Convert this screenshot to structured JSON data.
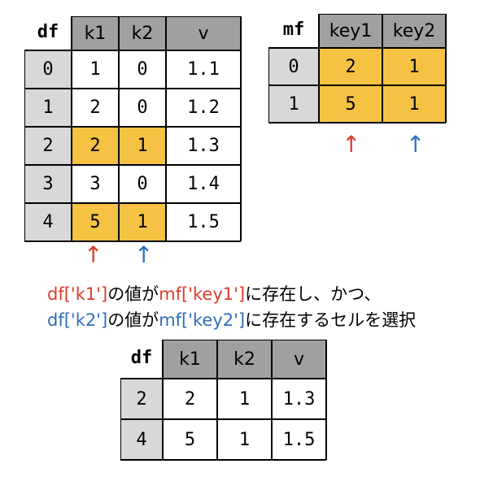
{
  "df": {
    "label": "df",
    "columns": [
      "k1",
      "k2",
      "v"
    ],
    "rows": [
      {
        "index": "0",
        "values": [
          "1",
          "0",
          "1.1"
        ],
        "highlight": [
          false,
          false,
          false
        ]
      },
      {
        "index": "1",
        "values": [
          "2",
          "0",
          "1.2"
        ],
        "highlight": [
          false,
          false,
          false
        ]
      },
      {
        "index": "2",
        "values": [
          "2",
          "1",
          "1.3"
        ],
        "highlight": [
          true,
          true,
          false
        ]
      },
      {
        "index": "3",
        "values": [
          "3",
          "0",
          "1.4"
        ],
        "highlight": [
          false,
          false,
          false
        ]
      },
      {
        "index": "4",
        "values": [
          "5",
          "1",
          "1.5"
        ],
        "highlight": [
          true,
          true,
          false
        ]
      }
    ]
  },
  "mf": {
    "label": "mf",
    "columns": [
      "key1",
      "key2"
    ],
    "rows": [
      {
        "index": "0",
        "values": [
          "2",
          "1"
        ],
        "highlight": [
          true,
          true
        ]
      },
      {
        "index": "1",
        "values": [
          "5",
          "1"
        ],
        "highlight": [
          true,
          true
        ]
      }
    ]
  },
  "result": {
    "label": "df",
    "columns": [
      "k1",
      "k2",
      "v"
    ],
    "rows": [
      {
        "index": "2",
        "values": [
          "2",
          "1",
          "1.3"
        ],
        "highlight": [
          false,
          false,
          false
        ]
      },
      {
        "index": "4",
        "values": [
          "5",
          "1",
          "1.5"
        ],
        "highlight": [
          false,
          false,
          false
        ]
      }
    ]
  },
  "arrows": {
    "glyph": "↑",
    "red": "#e03a2f",
    "blue": "#2f6fb8"
  },
  "condition": {
    "line1": {
      "a": "df['k1']",
      "b": "の値が",
      "c": "mf['key1']",
      "d": "に存在し、かつ、"
    },
    "line2": {
      "a": "df['k2']",
      "b": "の値が",
      "c": "mf['key2']",
      "d": "に存在するセルを選択"
    }
  },
  "colors": {
    "header": "#a0a0a0",
    "index": "#d8d8d8",
    "highlight": "#f6c244"
  }
}
